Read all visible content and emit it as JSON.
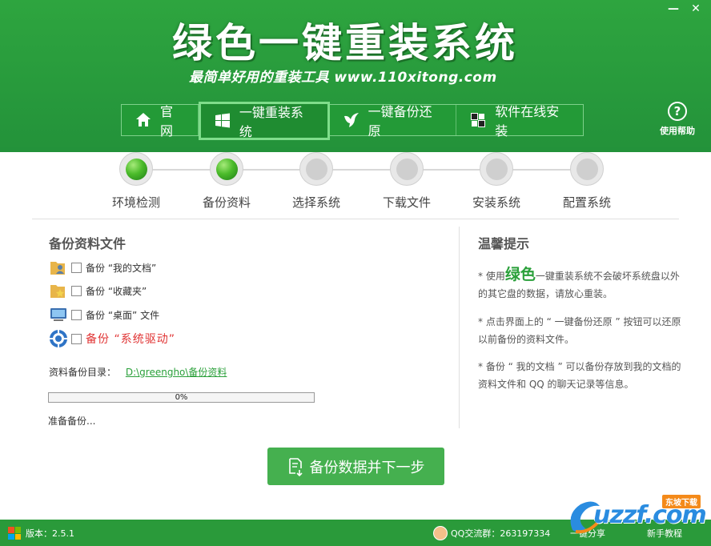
{
  "window": {
    "title": "绿色一键重装系统",
    "subtitle": "最简单好用的重装工具 www.110xitong.com",
    "min_label": "—",
    "close_label": "✕"
  },
  "nav": {
    "items": [
      {
        "label": "官网",
        "icon": "home-icon"
      },
      {
        "label": "一键重装系统",
        "icon": "windows-icon",
        "active": true
      },
      {
        "label": "一键备份还原",
        "icon": "bird-icon"
      },
      {
        "label": "软件在线安装",
        "icon": "app-grid-icon"
      }
    ],
    "help_label": "使用帮助",
    "help_glyph": "?"
  },
  "steps": [
    {
      "label": "环境检测",
      "done": true
    },
    {
      "label": "备份资料",
      "done": true
    },
    {
      "label": "选择系统",
      "done": false
    },
    {
      "label": "下载文件",
      "done": false
    },
    {
      "label": "安装系统",
      "done": false
    },
    {
      "label": "配置系统",
      "done": false
    }
  ],
  "backup": {
    "title": "备份资料文件",
    "items": [
      {
        "label": "备份 “我的文档”",
        "icon": "user-folder-icon",
        "checked": false
      },
      {
        "label": "备份 “收藏夹”",
        "icon": "star-folder-icon",
        "checked": false
      },
      {
        "label": "备份 “桌面” 文件",
        "icon": "desktop-icon",
        "checked": false
      },
      {
        "label": "备份 “系统驱动”",
        "icon": "gear-icon",
        "checked": false
      }
    ],
    "dir_label": "资料备份目录：",
    "dir_path": "D:\\greengho\\备份资料",
    "progress_percent": 0,
    "progress_text": "0%",
    "status": "准备备份..."
  },
  "tips": {
    "title": "温馨提示",
    "tip1_pre": "* 使用",
    "tip1_brand": "绿色",
    "tip1_post": "一键重装系统不会破坏系统盘以外的其它盘的数据，请放心重装。",
    "tip2": "* 点击界面上的 “ 一键备份还原 ” 按钮可以还原以前备份的资料文件。",
    "tip3": "* 备份 “ 我的文档 ” 可以备份存放到我的文档的资料文件和 QQ 的聊天记录等信息。"
  },
  "next_button": "备份数据并下一步",
  "footer": {
    "version": "版本：2.5.1",
    "qq_group": "QQ交流群：263197334",
    "share": "一键分享",
    "tutorial": "新手教程"
  },
  "watermark": {
    "text": "uzzf.com",
    "badge": "东坡下载"
  },
  "colors": {
    "brand_green": "#2a9a3a",
    "button_green": "#45b04f",
    "alert_red": "#e03333"
  }
}
